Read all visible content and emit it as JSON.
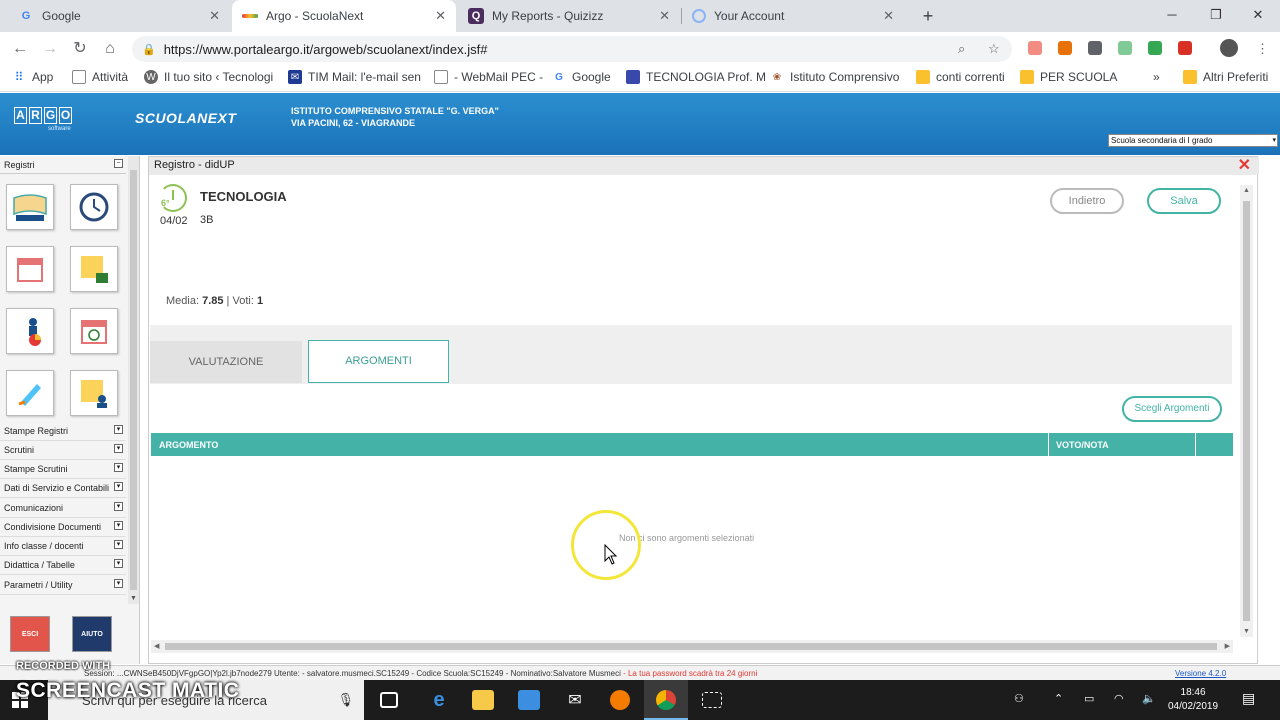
{
  "browser": {
    "tabs": [
      {
        "title": "Google",
        "icon": "google-icon"
      },
      {
        "title": "Argo - ScuolaNext",
        "icon": "argo-icon"
      },
      {
        "title": "My Reports - Quizizz",
        "icon": "quizizz-icon"
      },
      {
        "title": "Your Account",
        "icon": "account-icon"
      }
    ],
    "url": "https://www.portaleargo.it/argoweb/scuolanext/index.jsf#",
    "bookmarks": [
      {
        "label": "App",
        "icon": "apps-grid-icon"
      },
      {
        "label": "Attività",
        "icon": "page-icon"
      },
      {
        "label": "Il tuo sito ‹ Tecnologi",
        "icon": "wordpress-icon"
      },
      {
        "label": "TIM Mail: l'e-mail sen",
        "icon": "mail-icon"
      },
      {
        "label": "- WebMail PEC -",
        "icon": "page-icon"
      },
      {
        "label": "Google",
        "icon": "google-icon"
      },
      {
        "label": "TECNOLOGIA Prof. M",
        "icon": "site-icon"
      },
      {
        "label": "Istituto Comprensivo",
        "icon": "school-icon"
      },
      {
        "label": "conti correnti",
        "icon": "folder-icon"
      },
      {
        "label": "PER SCUOLA",
        "icon": "folder-icon"
      },
      {
        "label": "»",
        "icon": ""
      },
      {
        "label": "Altri Preferiti",
        "icon": "folder-icon"
      }
    ]
  },
  "header": {
    "logo": "ARGO",
    "logo_sub": "software",
    "product": "SCUOLANEXT",
    "school_line1": "ISTITUTO COMPRENSIVO STATALE \"G. VERGA\"",
    "school_line2": "VIA PACINI, 62 - VIAGRANDE",
    "school_select": "Scuola secondaria di I grado"
  },
  "sidebar": {
    "head": "Registri",
    "menu": [
      "Stampe Registri",
      "Scrutini",
      "Stampe Scrutini",
      "Dati di Servizio e Contabili",
      "Comunicazioni",
      "Condivisione Documenti",
      "Info classe / docenti",
      "Didattica / Tabelle",
      "Parametri / Utility"
    ],
    "exit_label": "ESCI",
    "help_label": "AIUTO"
  },
  "panel": {
    "title": "Registro - didUP",
    "hour": "6°",
    "date": "04/02",
    "subject": "TECNOLOGIA",
    "class": "3B",
    "back_label": "Indietro",
    "save_label": "Salva",
    "avg_label": "Media: ",
    "avg_value": "7.85",
    "votes_label": " | Voti: ",
    "votes_value": "1",
    "tab_valutazione": "VALUTAZIONE",
    "tab_argomenti": "ARGOMENTI",
    "choose_args_label": "Scegli Argomenti",
    "col_argomento": "ARGOMENTO",
    "col_voto": "VOTO/NOTA",
    "empty_message": "Non ci sono argomenti selezionati"
  },
  "status": {
    "text": "Session: ...CWNSeB450DjVFgpGO|Yp2l.jb7node279 Utente: - salvatore.musmeci.SC15249 - Codice Scuola:SC15249 - Nominativo:Salvatore Musmeci",
    "warning": "- La tua password scadrà tra 24 giorni",
    "version": "Versione 4.2.0"
  },
  "taskbar": {
    "search_placeholder": "Scrivi qui per eseguire la ricerca",
    "time": "18:46",
    "date": "04/02/2019"
  },
  "watermark": {
    "line1": "RECORDED WITH",
    "line2": "SCREENCAST MATIC"
  },
  "colors": {
    "accent": "#45b2a7",
    "header_blue": "#1b72b8",
    "lesson_green": "#8cc152",
    "warning_red": "#e53935"
  }
}
